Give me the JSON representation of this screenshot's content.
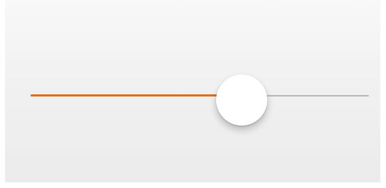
{
  "slider": {
    "value_fraction": 0.624,
    "colors": {
      "fill": "#e06a1e",
      "track": "#b7b7b7",
      "thumb": "#ffffff"
    }
  }
}
